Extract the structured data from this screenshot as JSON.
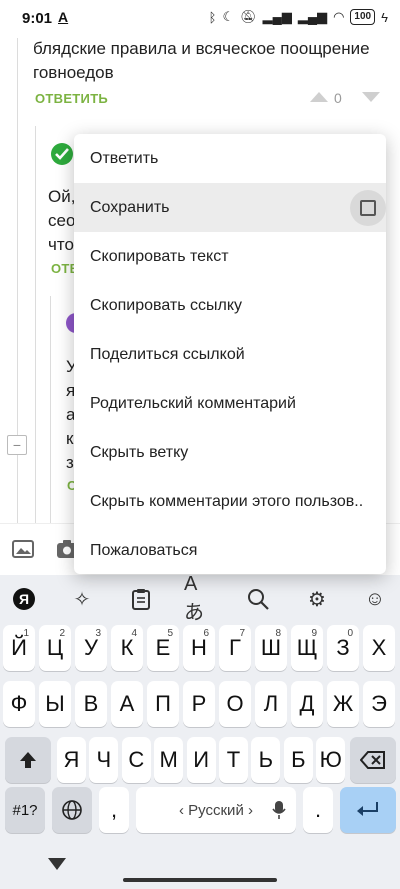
{
  "status_bar": {
    "time": "9:01",
    "indicator": "A",
    "battery": "100"
  },
  "comments": {
    "top_text": "блядские правила и всяческое поощрение говноедов",
    "top_reply": "ОТВЕТИТЬ",
    "top_votes": "0",
    "second_text_fragments": [
      "Ой,",
      "сео",
      "что"
    ],
    "second_reply_fragment": "ОТВ",
    "third_text_fragments": [
      "У",
      "я",
      "а",
      "к",
      "з"
    ],
    "third_reply_fragment": "О"
  },
  "context_menu": {
    "items": [
      "Ответить",
      "Сохранить",
      "Скопировать текст",
      "Скопировать ссылку",
      "Поделиться ссылкой",
      "Родительский комментарий",
      "Скрыть ветку",
      "Скрыть комментарии этого пользов..",
      "Пожаловаться"
    ],
    "save_checked": false
  },
  "keyboard": {
    "row1": [
      {
        "k": "Й",
        "h": "1"
      },
      {
        "k": "Ц",
        "h": "2"
      },
      {
        "k": "У",
        "h": "3"
      },
      {
        "k": "К",
        "h": "4"
      },
      {
        "k": "Е",
        "h": "5"
      },
      {
        "k": "Н",
        "h": "6"
      },
      {
        "k": "Г",
        "h": "7"
      },
      {
        "k": "Ш",
        "h": "8"
      },
      {
        "k": "Щ",
        "h": "9"
      },
      {
        "k": "З",
        "h": "0"
      },
      {
        "k": "Х",
        "h": ""
      }
    ],
    "row2": [
      "Ф",
      "Ы",
      "В",
      "А",
      "П",
      "Р",
      "О",
      "Л",
      "Д",
      "Ж",
      "Э"
    ],
    "row3": [
      "Я",
      "Ч",
      "С",
      "М",
      "И",
      "Т",
      "Ь",
      "Б",
      "Ю"
    ],
    "symbols_key": "#1?",
    "comma_key": ",",
    "period_key": ".",
    "space_label": "‹ Русский ›"
  }
}
